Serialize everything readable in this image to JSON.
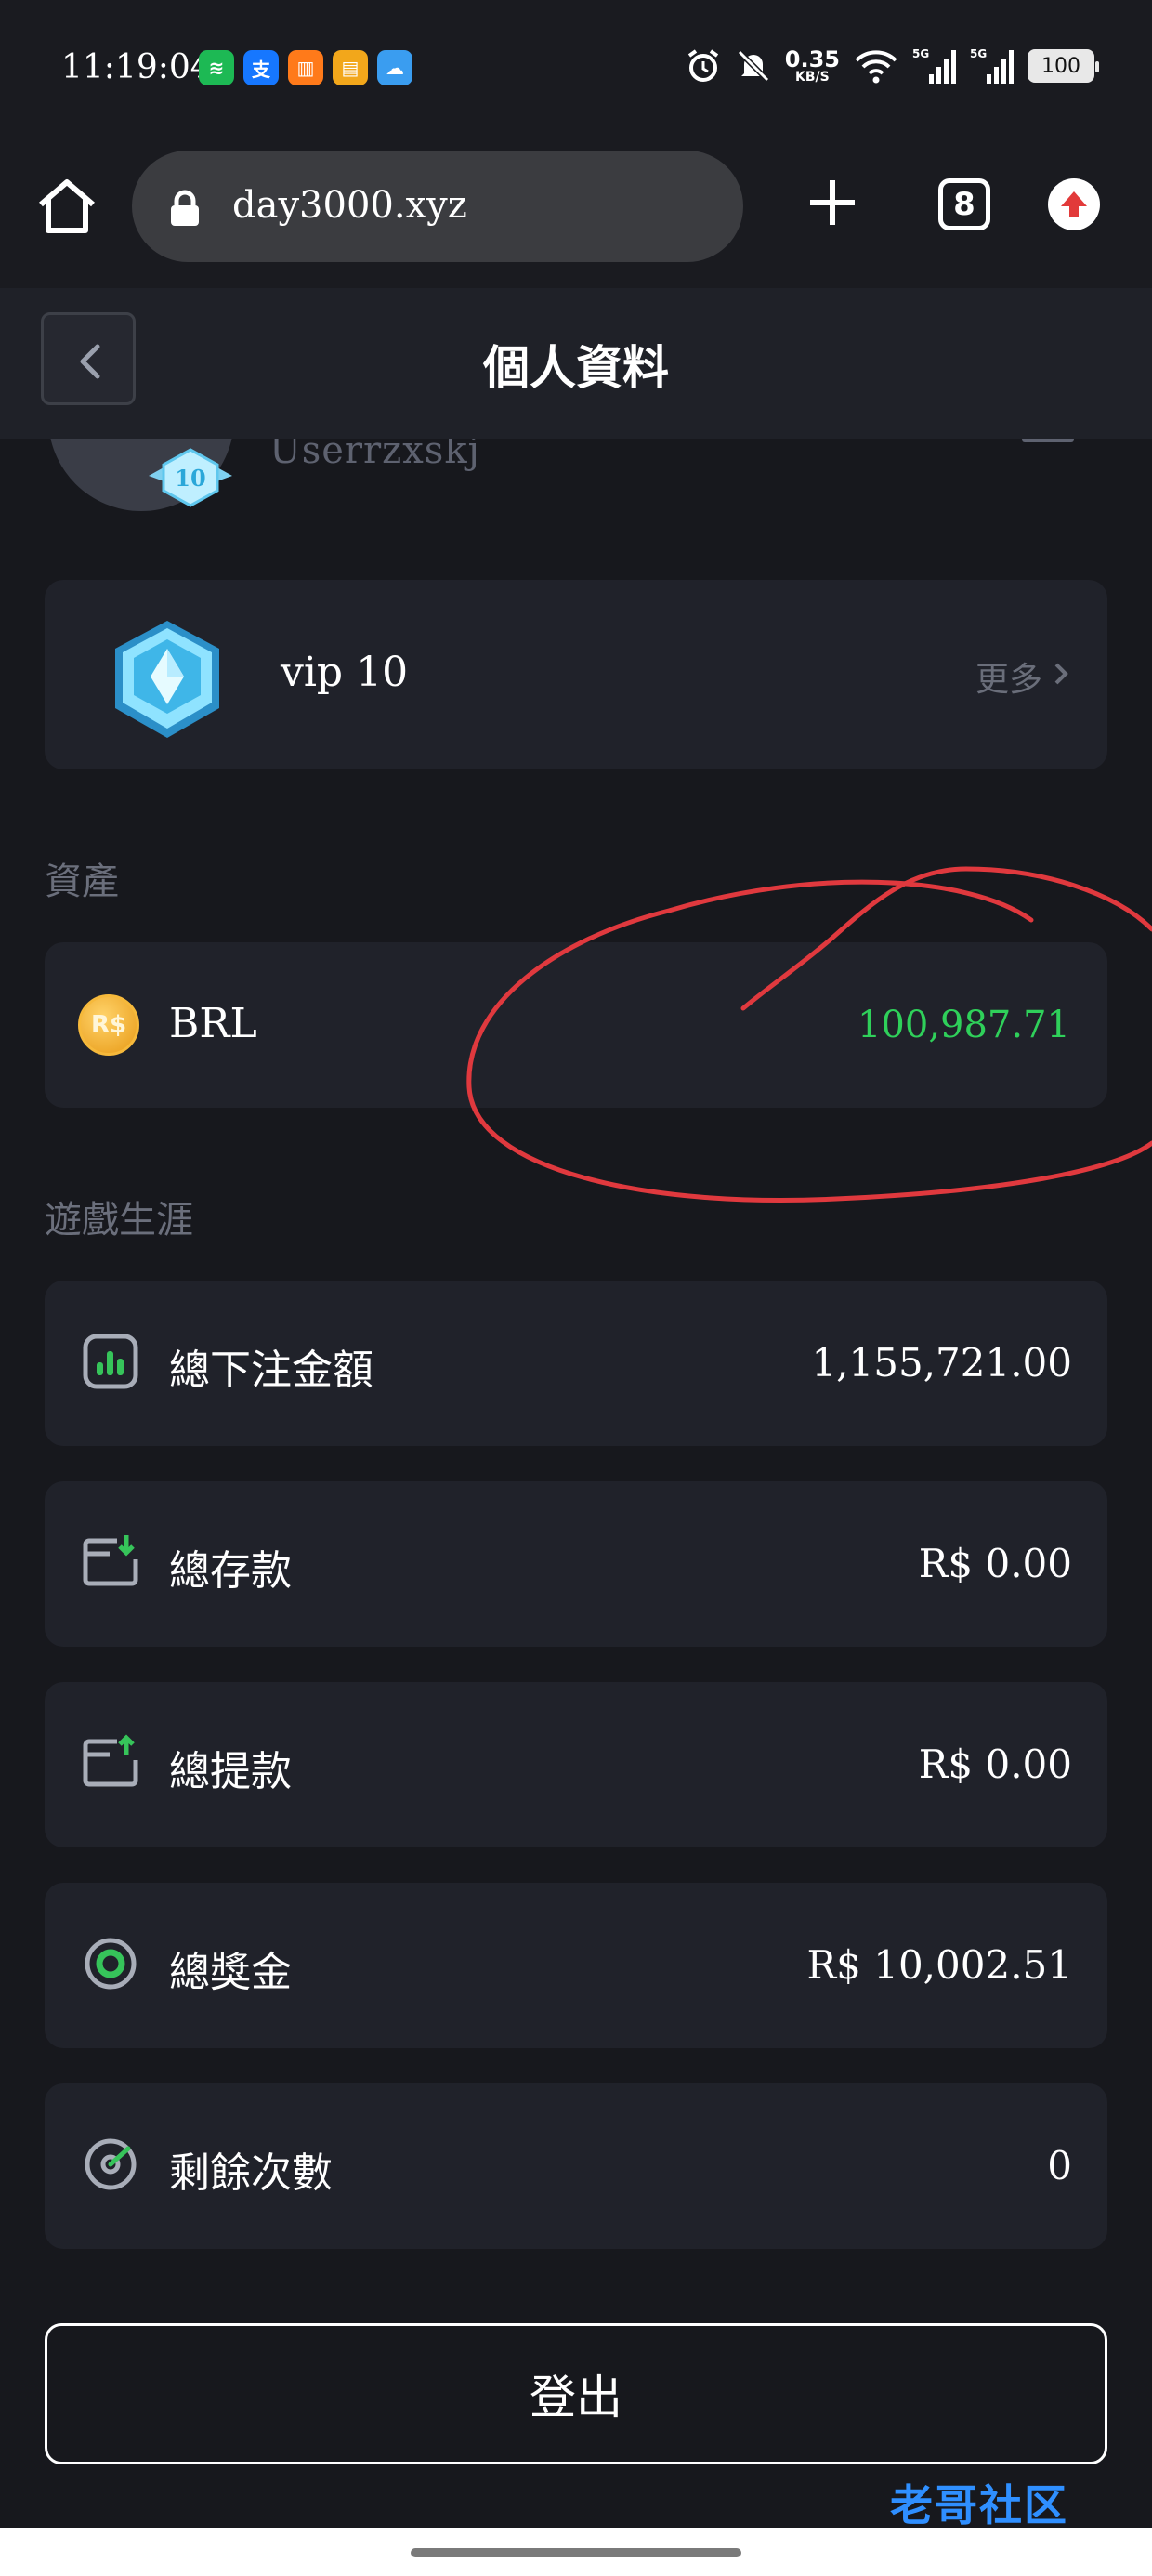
{
  "status_bar": {
    "time": "11:19:04",
    "net_speed_value": "0.35",
    "net_speed_unit": "KB/S",
    "battery": "100",
    "icons": [
      "spotify-icon",
      "alipay-icon",
      "books-icon",
      "wallet-icon",
      "weather-icon",
      "alarm-icon",
      "mute-icon",
      "wifi-icon",
      "signal-5g-icon",
      "signal-5g-icon",
      "battery-icon"
    ]
  },
  "browser": {
    "url": "day3000.xyz",
    "tab_count": "8"
  },
  "header": {
    "title": "個人資料"
  },
  "profile": {
    "username": "Userrzxskj",
    "level": "10"
  },
  "vip": {
    "label": "vip 10",
    "more": "更多"
  },
  "assets": {
    "section_title": "資產",
    "coin_symbol": "R$",
    "currency": "BRL",
    "balance": "100,987.71"
  },
  "career": {
    "section_title": "遊戲生涯",
    "stats": [
      {
        "label": "總下注金額",
        "value": "1,155,721.00",
        "icon": "bet-chart-icon"
      },
      {
        "label": "總存款",
        "value": "R$ 0.00",
        "icon": "deposit-icon"
      },
      {
        "label": "總提款",
        "value": "R$ 0.00",
        "icon": "withdraw-icon"
      },
      {
        "label": "總獎金",
        "value": "R$ 10,002.51",
        "icon": "bonus-target-icon"
      },
      {
        "label": "剩餘次數",
        "value": "0",
        "icon": "remaining-gauge-icon"
      }
    ]
  },
  "logout_label": "登出",
  "watermark": "老哥社区",
  "colors": {
    "background": "#17181d",
    "card": "#20222a",
    "balance_green": "#2fd05a",
    "icon_green": "#36c45a",
    "annotation_red": "#e0393e"
  }
}
